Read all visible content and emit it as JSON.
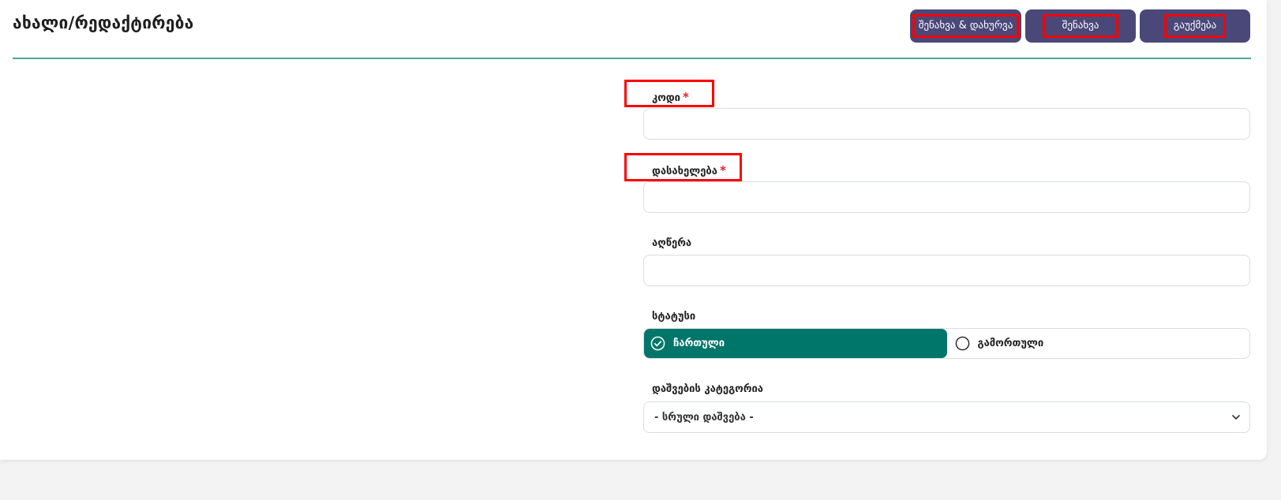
{
  "header": {
    "title": "ახალი/რედაქტირება",
    "buttons": {
      "save_close": "შენახვა & დახურვა",
      "save": "შენახვა",
      "cancel": "გაუქმება"
    }
  },
  "form": {
    "code": {
      "label": "კოდი",
      "required_mark": "*",
      "value": ""
    },
    "name": {
      "label": "დასახელება",
      "required_mark": "*",
      "value": ""
    },
    "description": {
      "label": "აღწერა",
      "value": ""
    },
    "status": {
      "label": "სტატუსი",
      "options": [
        "ჩართული",
        "გამორთული"
      ],
      "selected": "ჩართული"
    },
    "discount_category": {
      "label": "დაშვების კატეგორია",
      "selected": "- სრული დაშვება -"
    }
  },
  "colors": {
    "button_bg": "#4a4878",
    "accent_teal": "#00766a",
    "header_line": "#4aa89e",
    "required": "#e0202a",
    "highlight": "#ff0000"
  }
}
